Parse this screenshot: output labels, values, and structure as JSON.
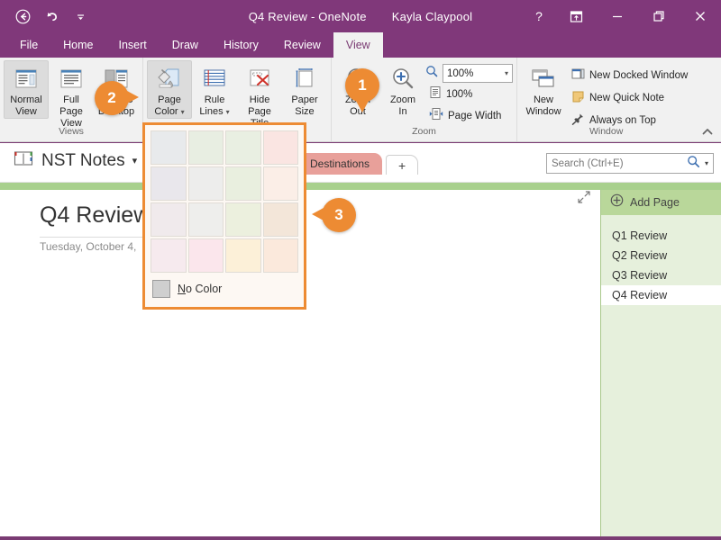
{
  "window": {
    "title": "Q4 Review - OneNote",
    "user": "Kayla Claypool",
    "back_icon": "back-arrow-icon",
    "undo_icon": "undo-icon",
    "qat_more_icon": "chevron-down-icon",
    "help_icon": "question-mark-icon",
    "ribbon_display_icon": "ribbon-display-options-icon",
    "minimize_icon": "minimize-icon",
    "restore_icon": "restore-icon",
    "close_icon": "close-icon"
  },
  "ribbon": {
    "tabs": [
      {
        "label": "File",
        "active": false
      },
      {
        "label": "Home",
        "active": false
      },
      {
        "label": "Insert",
        "active": false
      },
      {
        "label": "Draw",
        "active": false
      },
      {
        "label": "History",
        "active": false
      },
      {
        "label": "Review",
        "active": false
      },
      {
        "label": "View",
        "active": true
      }
    ],
    "collapse_icon": "chevron-up-icon",
    "groups": [
      {
        "name": "Views",
        "label": "Views",
        "buttons": [
          {
            "label": "Normal\nView",
            "selected": true,
            "icon": "normal-view-icon"
          },
          {
            "label": "Full Page\nView",
            "selected": false,
            "icon": "full-page-view-icon"
          },
          {
            "label": "Dock to\nDesktop",
            "selected": false,
            "icon": "dock-to-desktop-icon"
          }
        ]
      },
      {
        "name": "PageSetup",
        "label": "",
        "buttons": [
          {
            "label": "Page\nColor",
            "dropdown": true,
            "selected": true,
            "icon": "page-color-icon"
          },
          {
            "label": "Rule\nLines",
            "dropdown": true,
            "selected": false,
            "icon": "rule-lines-icon"
          },
          {
            "label": "Hide\nPage Title",
            "dropdown": false,
            "selected": false,
            "icon": "hide-page-title-icon"
          },
          {
            "label": "Paper\nSize",
            "dropdown": false,
            "selected": false,
            "icon": "paper-size-icon"
          }
        ]
      },
      {
        "name": "Zoom",
        "label": "Zoom",
        "buttons": [
          {
            "label": "Zoom\nOut",
            "icon": "zoom-out-icon"
          },
          {
            "label": "Zoom\nIn",
            "icon": "zoom-in-icon"
          }
        ],
        "zoom_value": "100%",
        "zoom_100_label": "100%",
        "page_width_label": "Page Width"
      },
      {
        "name": "Window",
        "label": "Window",
        "buttons": [
          {
            "label": "New\nWindow",
            "icon": "new-window-icon"
          }
        ],
        "small_buttons": [
          {
            "label": "New Docked Window",
            "icon": "new-docked-window-icon"
          },
          {
            "label": "New Quick Note",
            "icon": "new-quick-note-icon"
          },
          {
            "label": "Always on Top",
            "icon": "pin-icon"
          }
        ]
      }
    ]
  },
  "notebook": {
    "name": "NST Notes",
    "icon": "notebook-icon",
    "caret_icon": "chevron-down-icon",
    "section_tabs": [
      {
        "label": "Destinations",
        "color": "#e8a09a",
        "active": true
      }
    ],
    "add_section_label": "+",
    "strip_color": "#a8d08d"
  },
  "search": {
    "placeholder": "Search (Ctrl+E)",
    "icon": "search-icon",
    "caret_icon": "chevron-down-icon"
  },
  "page": {
    "title": "Q4 Review",
    "date": "Tuesday, October 4,",
    "expand_icon": "expand-arrows-icon"
  },
  "page_pane": {
    "add_page_label": "Add Page",
    "add_page_icon": "plus-circle-icon",
    "pages": [
      {
        "label": "Q1 Review",
        "active": false
      },
      {
        "label": "Q2 Review",
        "active": false
      },
      {
        "label": "Q3 Review",
        "active": false
      },
      {
        "label": "Q4 Review",
        "active": true
      }
    ]
  },
  "color_popup": {
    "no_color_label": "No Color",
    "no_color_mnemonic": "N",
    "no_color_rest": "o Color",
    "swatches": [
      "#e8eaec",
      "#e8eee2",
      "#e9efe2",
      "#fae5e2",
      "#e9e7ec",
      "#ededec",
      "#e9efdf",
      "#fbeee7",
      "#f0eaec",
      "#eeeeec",
      "#ecf0de",
      "#f3e6d9",
      "#f6eaee",
      "#fbe6ec",
      "#fcf0d8",
      "#fbe9dc"
    ]
  },
  "callouts": [
    {
      "number": "1",
      "direction": "down"
    },
    {
      "number": "2",
      "direction": "right"
    },
    {
      "number": "3",
      "direction": "left"
    }
  ],
  "colors": {
    "brand_purple": "#80387a",
    "accent_orange": "#ed8b33",
    "section_green": "#a8d08d",
    "pane_green": "#e6f0dc"
  }
}
